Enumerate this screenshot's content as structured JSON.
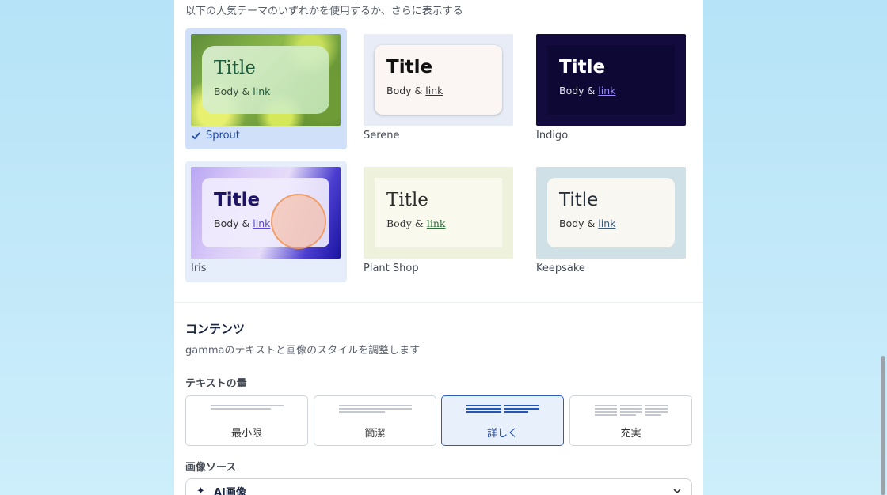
{
  "intro_text": "以下の人気テーマのいずれかを使用するか、さらに表示する",
  "themes": [
    {
      "name": "Sprout",
      "title": "Title",
      "body": "Body &",
      "link": "link",
      "selected": true
    },
    {
      "name": "Serene",
      "title": "Title",
      "body": "Body &",
      "link": "link"
    },
    {
      "name": "Indigo",
      "title": "Title",
      "body": "Body &",
      "link": "link"
    },
    {
      "name": "Iris",
      "title": "Title",
      "body": "Body &",
      "link": "link"
    },
    {
      "name": "Plant Shop",
      "title": "Title",
      "body": "Body &",
      "link": "link"
    },
    {
      "name": "Keepsake",
      "title": "Title",
      "body": "Body &",
      "link": "link"
    }
  ],
  "content": {
    "title": "コンテンツ",
    "description": "gammaのテキストと画像のスタイルを調整します",
    "text_amount_label": "テキストの量",
    "text_amount_options": [
      "最小限",
      "簡潔",
      "詳しく",
      "充実"
    ],
    "text_amount_selected": "詳しく",
    "image_source_label": "画像ソース",
    "image_source_value": "AI画像"
  },
  "colors": {
    "accent": "#1e4aa8",
    "selected_bg": "#cfe0f8"
  }
}
